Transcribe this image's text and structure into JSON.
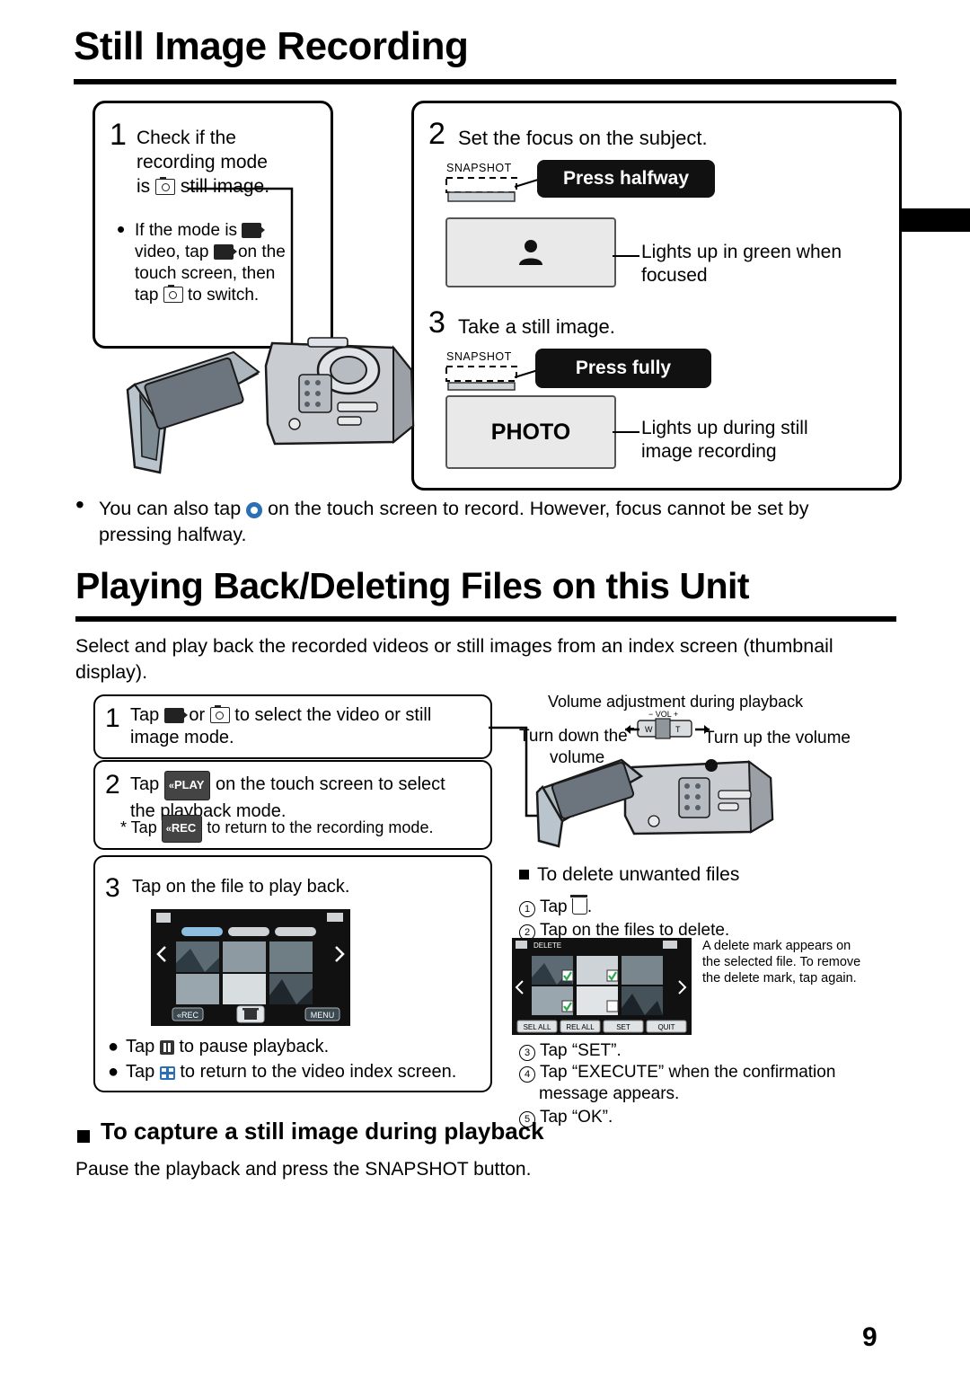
{
  "page": {
    "number": "9"
  },
  "section1": {
    "title": "Still Image Recording",
    "step1": {
      "num": "1",
      "line1": "Check if the",
      "line2": "recording mode",
      "line3_a": "is",
      "line3_b": "still image.",
      "bullet_a": "If the mode is",
      "bullet_b": "video, tap",
      "bullet_c": "on the",
      "bullet_d": "touch screen, then",
      "bullet_e": "tap",
      "bullet_f": "to switch."
    },
    "step2": {
      "num": "2",
      "text": "Set the focus on the subject.",
      "snapshot_label": "SNAPSHOT",
      "press_label": "Press halfway",
      "callout_line1": "Lights up in green when",
      "callout_line2": "focused"
    },
    "step3": {
      "num": "3",
      "text": "Take a still image.",
      "snapshot_label": "SNAPSHOT",
      "press_label": "Press fully",
      "photo_label": "PHOTO",
      "callout_line1": "Lights up during still",
      "callout_line2": "image recording"
    },
    "bullet": {
      "line1_a": "You can also tap",
      "line1_b": "on the touch screen to record. However, focus cannot be set by",
      "line2": "pressing halfway."
    }
  },
  "section2": {
    "title": "Playing Back/Deleting Files on this Unit",
    "intro_line1": "Select and play back the recorded videos or still images from an index screen (thumbnail",
    "intro_line2": "display).",
    "step1": {
      "num": "1",
      "a": "Tap",
      "b": "or",
      "c": "to select the video or still",
      "d": "image mode."
    },
    "step2": {
      "num": "2",
      "play_chip": "PLAY",
      "a": "Tap",
      "b": "on the touch screen to select",
      "c": "the playback mode.",
      "note_a": "* Tap",
      "rec_chip": "REC",
      "note_b": "to return to the recording mode."
    },
    "step3": {
      "num": "3",
      "text": "Tap on the file to play back.",
      "bullet1_a": "Tap",
      "bullet1_b": "to pause playback.",
      "bullet2_a": "Tap",
      "bullet2_b": "to return to the video index screen.",
      "screen": {
        "rec_button": "REC",
        "menu_button": "MENU"
      }
    },
    "volume": {
      "title": "Volume adjustment during playback",
      "left_line1": "Turn down the",
      "left_line2": "volume",
      "right": "Turn up the volume",
      "slider_label": "VOL",
      "slider_minus": "−",
      "slider_plus": "+",
      "slider_w": "W",
      "slider_t": "T"
    },
    "delete": {
      "heading": "To delete unwanted files",
      "s1_a": "Tap",
      "s1_b": ".",
      "s2": "Tap on the files to delete.",
      "s3": "Tap “SET”.",
      "s4_line1": "Tap “EXECUTE” when the confirmation",
      "s4_line2": "message appears.",
      "s5": "Tap “OK”.",
      "note_line1": "A delete mark appears on",
      "note_line2": "the selected file. To remove",
      "note_line3": "the delete mark, tap again.",
      "screen": {
        "title": "DELETE",
        "b1": "SEL ALL",
        "b2": "REL ALL",
        "b3": "SET",
        "b4": "QUIT"
      }
    },
    "capture": {
      "heading": "To capture a still image during playback",
      "text": "Pause the playback and press the SNAPSHOT button."
    }
  }
}
